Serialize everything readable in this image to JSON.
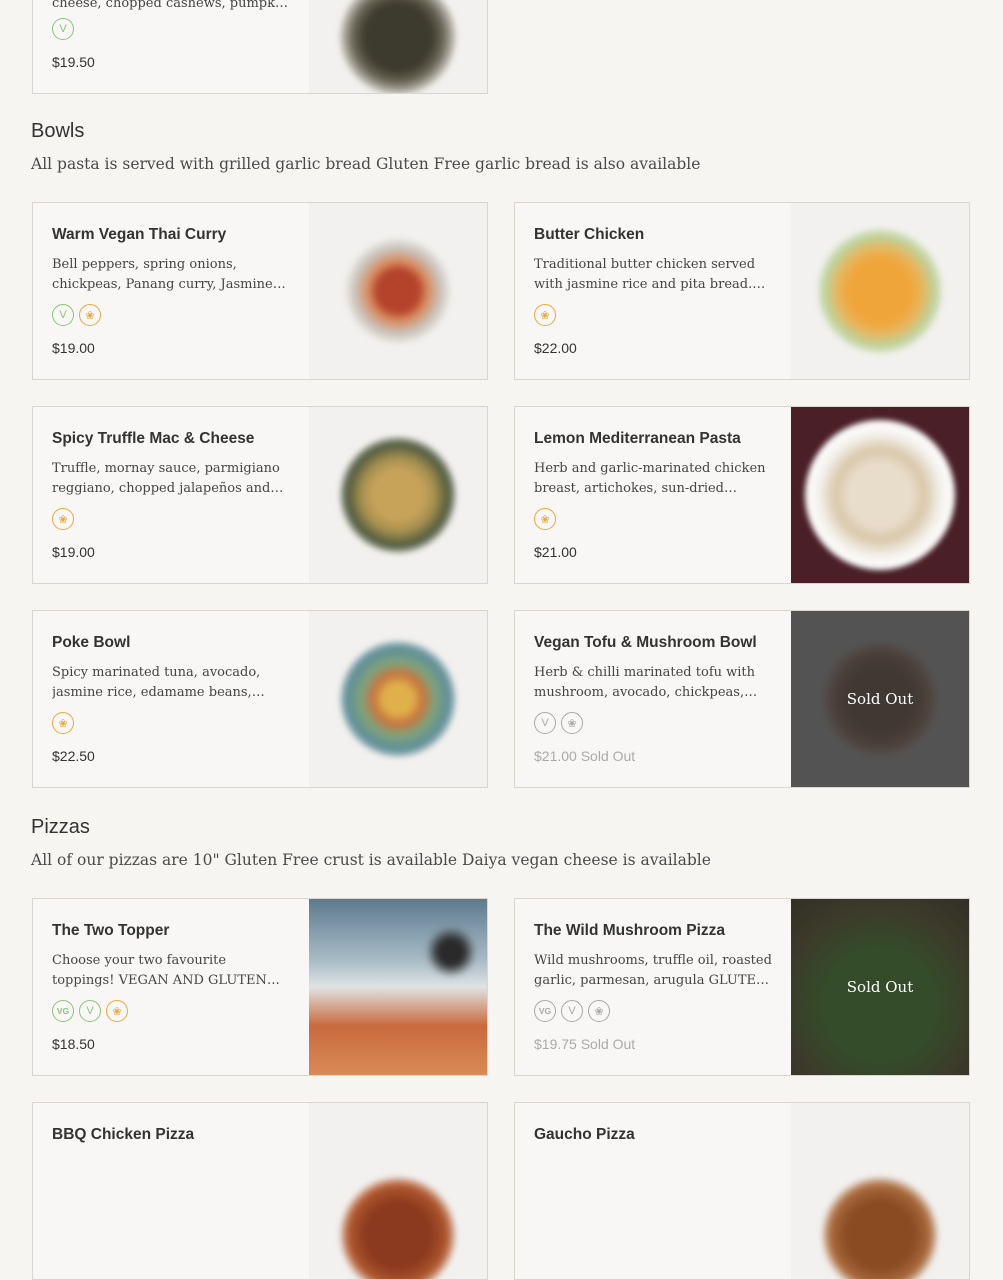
{
  "top_card": {
    "desc": "cheese, chopped cashews, pumpkin seeds",
    "badges": [
      "V"
    ],
    "price": "$19.50"
  },
  "sections": {
    "bowls": {
      "title": "Bowls",
      "description": "All pasta is served with grilled garlic bread Gluten Free garlic bread is also available",
      "items": [
        {
          "name": "Warm Vegan Thai Curry",
          "desc": "Bell peppers, spring onions, chickpeas, Panang curry, Jasmine rice",
          "badges": [
            "V",
            "GF"
          ],
          "price": "$19.00"
        },
        {
          "name": "Butter Chicken",
          "desc": "Traditional butter chicken served with jasmine rice and pita bread. GLUTEN FREE",
          "badges": [
            "GF"
          ],
          "price": "$22.00"
        },
        {
          "name": "Spicy Truffle Mac & Cheese",
          "desc": "Truffle, mornay sauce, parmigiano reggiano, chopped jalapeños and breadcrumbs",
          "badges": [
            "GF"
          ],
          "price": "$19.00"
        },
        {
          "name": "Lemon Mediterranean Pasta",
          "desc": "Herb and garlic-marinated chicken breast, artichokes, sun-dried tomatoes",
          "badges": [
            "GF"
          ],
          "price": "$21.00"
        },
        {
          "name": "Poke Bowl",
          "desc": "Spicy marinated tuna, avocado, jasmine rice, edamame beans, cucumber",
          "badges": [
            "GF"
          ],
          "price": "$22.50"
        },
        {
          "name": "Vegan Tofu & Mushroom Bowl",
          "desc": "Herb & chilli marinated tofu with mushroom, avocado, chickpeas, quinoa",
          "badges": [
            "V",
            "GF"
          ],
          "price": "$21.00 Sold Out",
          "overlay": "Sold Out"
        }
      ]
    },
    "pizzas": {
      "title": "Pizzas",
      "description": "All of our pizzas are 10\" Gluten Free crust is available Daiya vegan cheese is available",
      "items": [
        {
          "name": "The Two Topper",
          "desc": "Choose your two favourite toppings! VEGAN AND GLUTEN FREE OPTIONS",
          "badges": [
            "VG",
            "V",
            "GF"
          ],
          "price": "$18.50"
        },
        {
          "name": "The Wild Mushroom Pizza",
          "desc": "Wild mushrooms, truffle oil, roasted garlic, parmesan, arugula GLUTEN FREE",
          "badges": [
            "VG",
            "V",
            "GF"
          ],
          "price": "$19.75 Sold Out",
          "overlay": "Sold Out"
        },
        {
          "name": "BBQ Chicken Pizza"
        },
        {
          "name": "Gaucho Pizza"
        }
      ]
    }
  },
  "colors": {
    "background": "#f7f5f2",
    "vegan_badge": "#8cc47a",
    "gluten_free_badge": "#e8a93c",
    "sold_out_overlay": "#575757"
  },
  "icons": {
    "V": "vegetarian-icon",
    "VG": "vegan-icon",
    "GF": "gluten-free-wheat-icon"
  }
}
